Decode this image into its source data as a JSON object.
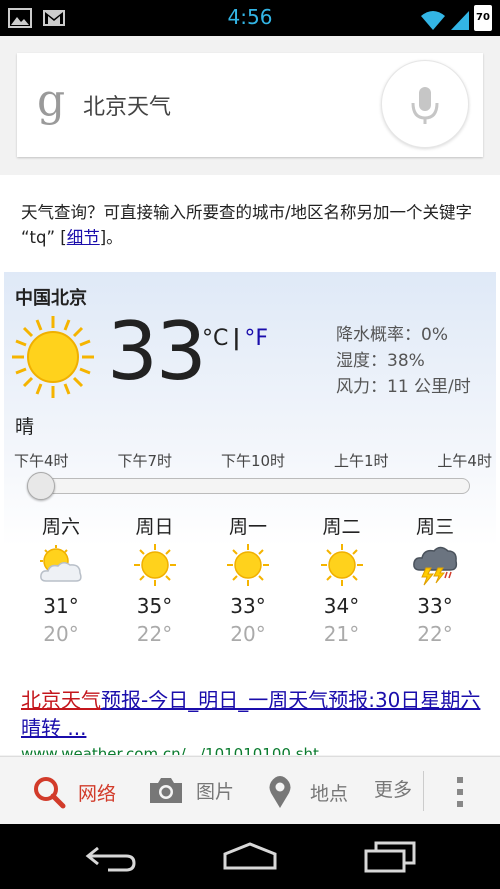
{
  "status_bar": {
    "time": "4:56",
    "battery": "70"
  },
  "search": {
    "query": "北京天气",
    "logo": "g"
  },
  "hint": {
    "text": "天气查询？可直接输入所要查的城市/地区名称另加一个关键字 “tq” [",
    "link": "细节",
    "suffix": "]。"
  },
  "weather": {
    "location": "中国北京",
    "temperature": "33",
    "unit_c": "°C",
    "unit_sep": "|",
    "unit_f": "°F",
    "precipitation": "降水概率：0%",
    "humidity": "湿度：38%",
    "wind": "风力：11 公里/时",
    "condition": "晴",
    "hours": [
      "下午4时",
      "下午7时",
      "下午10时",
      "上午1时",
      "上午4时"
    ],
    "slider_position": 0,
    "forecast": [
      {
        "day": "周六",
        "icon": "partly-cloudy-icon",
        "high": "31°",
        "low": "20°"
      },
      {
        "day": "周日",
        "icon": "sun-icon",
        "high": "35°",
        "low": "22°"
      },
      {
        "day": "周一",
        "icon": "sun-icon",
        "high": "33°",
        "low": "20°"
      },
      {
        "day": "周二",
        "icon": "sun-icon",
        "high": "34°",
        "low": "21°"
      },
      {
        "day": "周三",
        "icon": "thunderstorm-icon",
        "high": "33°",
        "low": "22°"
      }
    ]
  },
  "result": {
    "title_highlight": "北京天气",
    "title_rest": "预报-今日_明日_一周天气预报:30日星期六晴转 ...",
    "url": "www.weather.com.cn/.../101010100.sht"
  },
  "bottom_tabs": {
    "web": "网络",
    "images": "图片",
    "places": "地点",
    "more": "更多"
  },
  "colors": {
    "accent_red": "#d23b2a",
    "link_blue": "#1a0dab",
    "status_blue": "#33b5e5"
  }
}
